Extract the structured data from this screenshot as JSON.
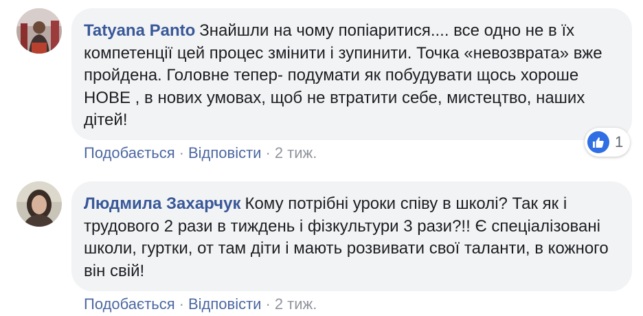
{
  "comments": [
    {
      "author": "Tatyana Panto",
      "text": "Знайшли на чому попіаритися.... все одно не в їх компетенції цей процес змінити і зупинити. Точка «невозврата» вже пройдена. Головне тепер- подумати як побудувати щось хороше НОВЕ , в нових умовах, щоб не втратити себе, мистецтво, наших дітей!",
      "like_label": "Подобається",
      "reply_label": "Відповісти",
      "separator": "·",
      "time": "2 тиж.",
      "reaction_count": "1",
      "reaction_icon": "like-icon"
    },
    {
      "author": "Людмила Захарчук",
      "text": "Кому потрібні уроки співу в школі? Так як і трудового 2 рази в тиждень і фізкультури 3 рази?!! Є спеціалізовані школи, гуртки, от там діти і мають розвивати свої таланти, в кожного він свій!",
      "like_label": "Подобається",
      "reply_label": "Відповісти",
      "separator": "·",
      "time": "2 тиж."
    }
  ],
  "colors": {
    "bubble": "#f2f3f5",
    "author": "#385898",
    "action_link": "#4b67a1",
    "meta": "#90949c",
    "like_blue": "#2f6fe3"
  }
}
